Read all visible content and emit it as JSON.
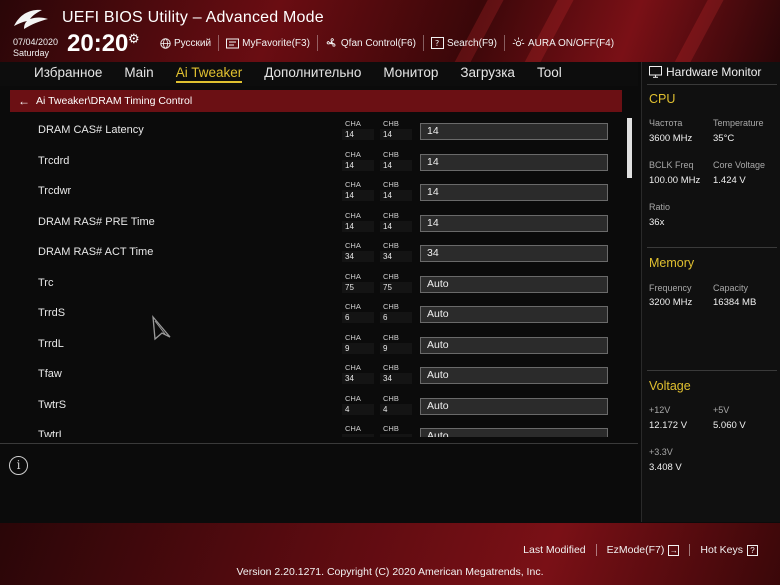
{
  "header": {
    "title": "UEFI BIOS Utility – Advanced Mode",
    "date": "07/04/2020",
    "day": "Saturday",
    "time": "20:20",
    "items": [
      {
        "icon": "globe-icon",
        "label": "Русский"
      },
      {
        "icon": "favorite-icon",
        "label": "MyFavorite(F3)"
      },
      {
        "icon": "fan-icon",
        "label": "Qfan Control(F6)"
      },
      {
        "icon": "search-icon",
        "label": "Search(F9)"
      },
      {
        "icon": "aura-icon",
        "label": "AURA ON/OFF(F4)"
      }
    ]
  },
  "nav": {
    "tabs": [
      {
        "label": "Избранное",
        "active": false
      },
      {
        "label": "Main",
        "active": false
      },
      {
        "label": "Ai Tweaker",
        "active": true
      },
      {
        "label": "Дополнительно",
        "active": false
      },
      {
        "label": "Монитор",
        "active": false
      },
      {
        "label": "Загрузка",
        "active": false
      },
      {
        "label": "Tool",
        "active": false
      }
    ]
  },
  "breadcrumb": "Ai Tweaker\\DRAM Timing Control",
  "channel_labels": {
    "a": "CHA",
    "b": "CHB"
  },
  "settings": [
    {
      "label": "DRAM CAS# Latency",
      "cha": "14",
      "chb": "14",
      "value": "14"
    },
    {
      "label": "Trcdrd",
      "cha": "14",
      "chb": "14",
      "value": "14"
    },
    {
      "label": "Trcdwr",
      "cha": "14",
      "chb": "14",
      "value": "14"
    },
    {
      "label": "DRAM RAS# PRE Time",
      "cha": "14",
      "chb": "14",
      "value": "14"
    },
    {
      "label": "DRAM RAS# ACT Time",
      "cha": "34",
      "chb": "34",
      "value": "34"
    },
    {
      "label": "Trc",
      "cha": "75",
      "chb": "75",
      "value": "Auto"
    },
    {
      "label": "TrrdS",
      "cha": "6",
      "chb": "6",
      "value": "Auto"
    },
    {
      "label": "TrrdL",
      "cha": "9",
      "chb": "9",
      "value": "Auto"
    },
    {
      "label": "Tfaw",
      "cha": "34",
      "chb": "34",
      "value": "Auto"
    },
    {
      "label": "TwtrS",
      "cha": "4",
      "chb": "4",
      "value": "Auto"
    },
    {
      "label": "TwtrL",
      "cha": "",
      "chb": "",
      "value": "Auto"
    }
  ],
  "hw_monitor": {
    "title": "Hardware Monitor",
    "cpu": {
      "title": "CPU",
      "freq_label": "Частота",
      "freq": "3600 MHz",
      "temp_label": "Temperature",
      "temp": "35°C",
      "bclk_label": "BCLK Freq",
      "bclk": "100.00 MHz",
      "vcore_label": "Core Voltage",
      "vcore": "1.424 V",
      "ratio_label": "Ratio",
      "ratio": "36x"
    },
    "memory": {
      "title": "Memory",
      "freq_label": "Frequency",
      "freq": "3200 MHz",
      "cap_label": "Capacity",
      "cap": "16384 MB"
    },
    "voltage": {
      "title": "Voltage",
      "v12_label": "+12V",
      "v12": "12.172 V",
      "v5_label": "+5V",
      "v5": "5.060 V",
      "v33_label": "+3.3V",
      "v33": "3.408 V"
    }
  },
  "footer": {
    "last_modified": "Last Modified",
    "ezmode": "EzMode(F7)",
    "hotkeys": "Hot Keys",
    "version": "Version 2.20.1271. Copyright (C) 2020 American Megatrends, Inc."
  }
}
